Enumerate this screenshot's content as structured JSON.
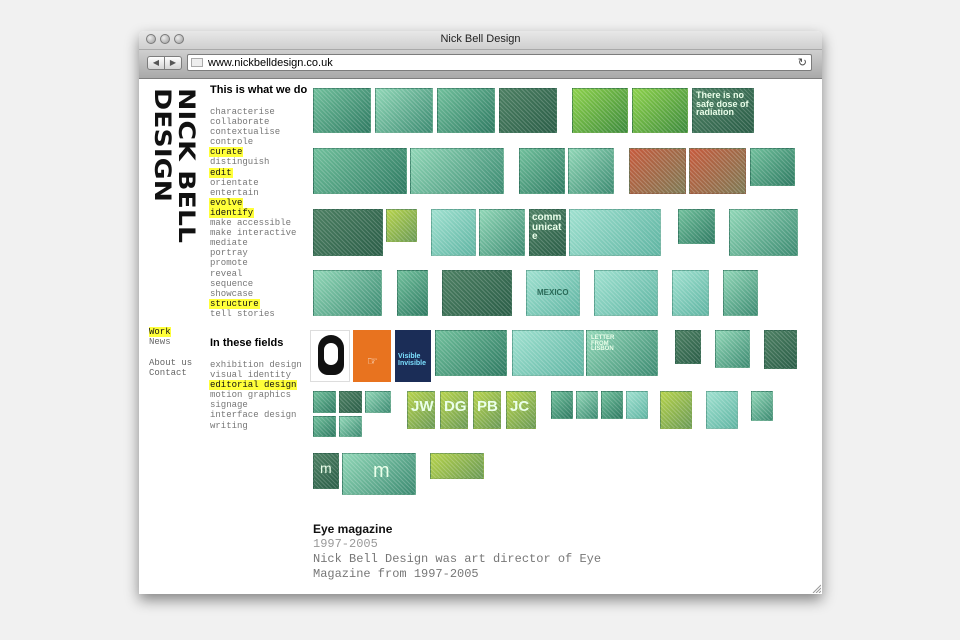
{
  "window": {
    "title": "Nick Bell Design",
    "url": "www.nickbelldesign.co.uk"
  },
  "logo": {
    "text_line1": "NICK BELL",
    "text_line2": "DESIGN"
  },
  "what_we_do": {
    "heading": "This is what we do",
    "items": [
      {
        "label": "characterise",
        "highlighted": false
      },
      {
        "label": "collaborate",
        "highlighted": false
      },
      {
        "label": "contextualise",
        "highlighted": false
      },
      {
        "label": "controle",
        "highlighted": false
      },
      {
        "label": "curate",
        "highlighted": true
      },
      {
        "label": "distinguish",
        "highlighted": false
      },
      {
        "label": "edit",
        "highlighted": true
      },
      {
        "label": "orientate",
        "highlighted": false
      },
      {
        "label": "entertain",
        "highlighted": false
      },
      {
        "label": "evolve",
        "highlighted": true
      },
      {
        "label": "identify",
        "highlighted": true
      },
      {
        "label": "make accessible",
        "highlighted": false
      },
      {
        "label": "make interactive",
        "highlighted": false
      },
      {
        "label": "mediate",
        "highlighted": false
      },
      {
        "label": "portray",
        "highlighted": false
      },
      {
        "label": "promote",
        "highlighted": false
      },
      {
        "label": "reveal",
        "highlighted": false
      },
      {
        "label": "sequence",
        "highlighted": false
      },
      {
        "label": "showcase",
        "highlighted": false
      },
      {
        "label": "structure",
        "highlighted": true
      },
      {
        "label": "tell stories",
        "highlighted": false
      }
    ]
  },
  "fields": {
    "heading": "In these fields",
    "items": [
      {
        "label": "exhibition design",
        "highlighted": false
      },
      {
        "label": "visual identity",
        "highlighted": false
      },
      {
        "label": "editorial design",
        "highlighted": true
      },
      {
        "label": "motion graphics",
        "highlighted": false
      },
      {
        "label": "signage",
        "highlighted": false
      },
      {
        "label": "interface design",
        "highlighted": false
      },
      {
        "label": "writing",
        "highlighted": false
      }
    ]
  },
  "nav": {
    "work": "Work",
    "news": "News",
    "about": "About us",
    "contact": "Contact"
  },
  "thumb_texts": {
    "radiation": "There is no safe dose of radiation",
    "communicate": "communicate",
    "mexico": "MEXICO",
    "visible": "Visible Invisible",
    "letter": "LETTER FROM LISBON",
    "jw": "JW",
    "dg": "DG",
    "pb": "PB",
    "jc": "JC",
    "m1": "m",
    "m2": "m"
  },
  "caption": {
    "title": "Eye magazine",
    "years": "1997-2005",
    "description": "Nick Bell Design was art director of Eye Magazine from 1997-2005"
  },
  "colors": {
    "highlight": "#ffff3a",
    "thumb_tint": "#6fbf9b",
    "poster_orange": "#e8731f"
  }
}
